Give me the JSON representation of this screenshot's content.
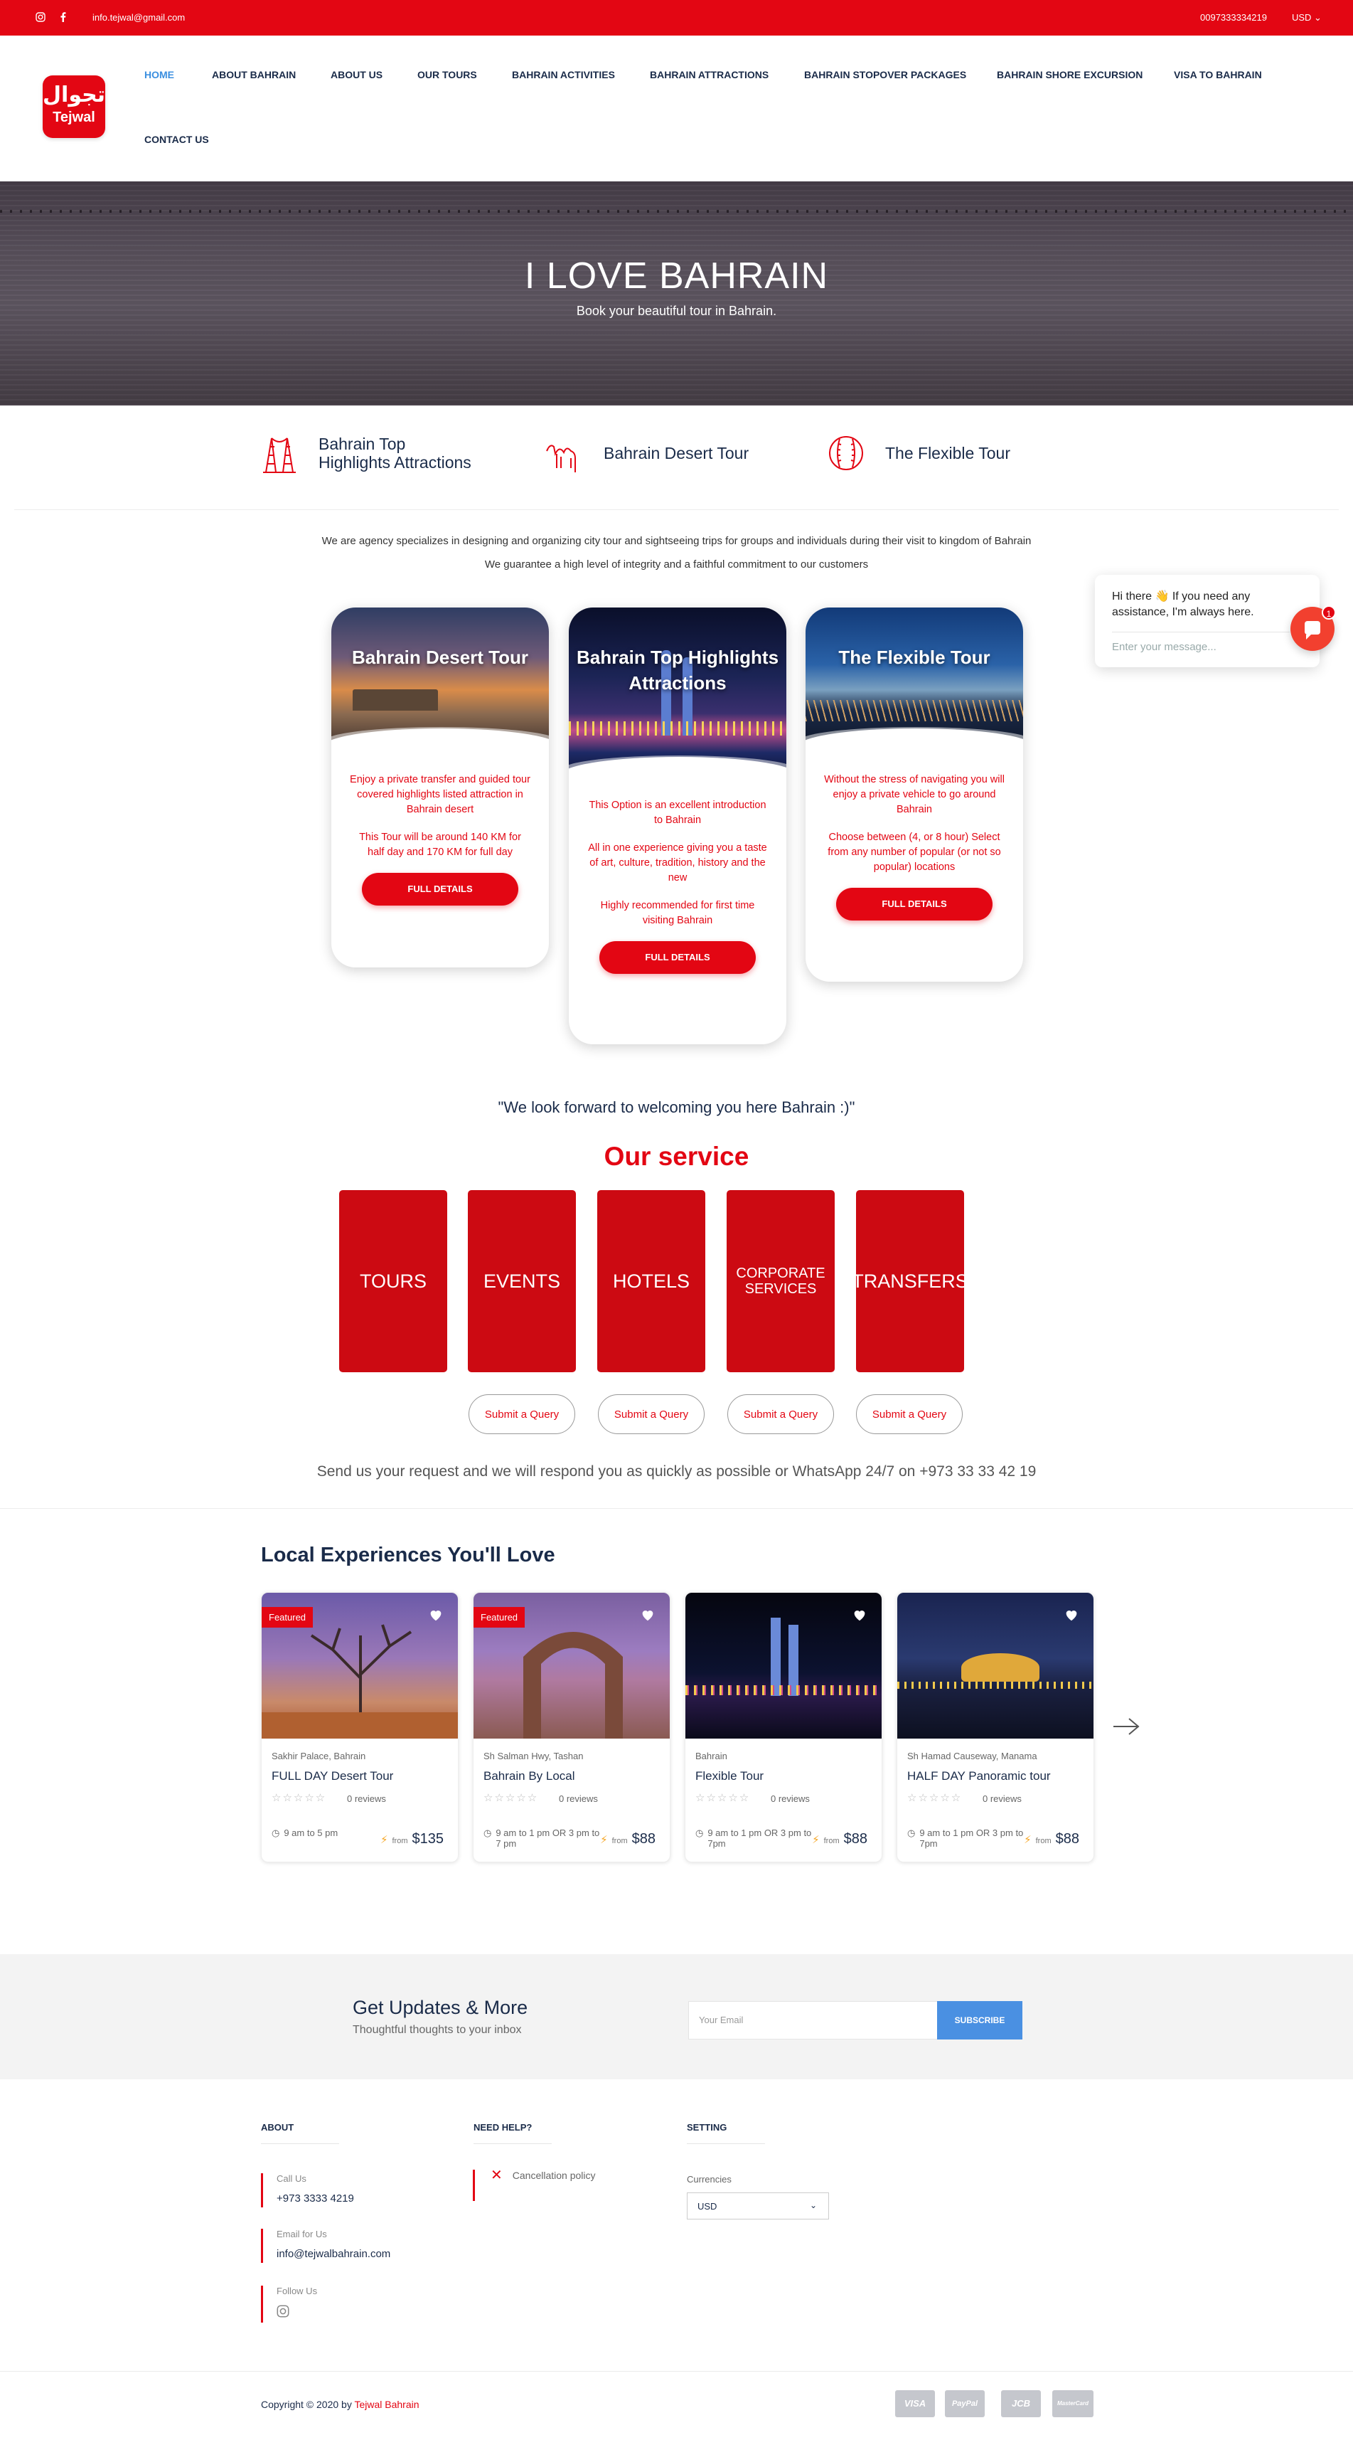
{
  "topbar": {
    "email": "info.tejwal@gmail.com",
    "phone": "0097333334219",
    "currency": "USD ⌄"
  },
  "logo": {
    "arabic": "تجوال",
    "latin": "Tejwal"
  },
  "nav": [
    "HOME",
    "ABOUT BAHRAIN",
    "ABOUT US",
    "OUR TOURS",
    "BAHRAIN ACTIVITIES",
    "BAHRAIN ATTRACTIONS",
    "BAHRAIN STOPOVER PACKAGES",
    "BAHRAIN SHORE EXCURSION",
    "VISA TO BAHRAIN",
    "CONTACT US"
  ],
  "hero": {
    "title": "I LOVE BAHRAIN",
    "subtitle": "Book your beautiful tour in Bahrain."
  },
  "features": [
    {
      "label": "Bahrain Top Highlights Attractions",
      "icon": "towers-icon"
    },
    {
      "label": "Bahrain Desert Tour",
      "icon": "camel-icon"
    },
    {
      "label": "The Flexible Tour",
      "icon": "ball-icon"
    }
  ],
  "intro": [
    "We are agency specializes in designing and organizing city tour and sightseeing trips for groups and individuals during their visit to kingdom of Bahrain",
    "We guarantee a high level of integrity and a faithful commitment to our customers"
  ],
  "tour_cards": [
    {
      "title": "Bahrain Desert Tour",
      "paragraphs": [
        "Enjoy a private transfer and guided tour covered highlights listed attraction in Bahrain desert",
        "This Tour will be around 140 KM for half day and 170 KM for full day"
      ],
      "button": "FULL DETAILS"
    },
    {
      "title": "Bahrain Top Highlights Attractions",
      "paragraphs": [
        "This Option is an excellent introduction to Bahrain",
        "All in one experience giving you a taste of art, culture, tradition, history and the new",
        "Highly recommended for first time visiting Bahrain"
      ],
      "button": "FULL DETAILS"
    },
    {
      "title": "The Flexible Tour",
      "paragraphs": [
        "Without the stress of navigating you will enjoy a private vehicle to go around Bahrain",
        "Choose between (4, or 8 hour) Select from any number of popular (or not so popular) locations"
      ],
      "button": "FULL DETAILS"
    }
  ],
  "chat": {
    "message": "Hi there 👋 If you need any assistance, I'm always here.",
    "placeholder": "Enter your message...",
    "badge": "1"
  },
  "quote": "\"We look forward to welcoming you here Bahrain :)\"",
  "services": {
    "title": "Our service",
    "items": [
      "TOURS",
      "EVENTS",
      "HOTELS",
      "CORPORATE SERVICES",
      "TRANSFERS"
    ],
    "query_label": "Submit a Query",
    "request_text": "Send us your request and we will respond you as quickly as possible or WhatsApp 24/7 on +973 33 33 42 19"
  },
  "experiences": {
    "title": "Local Experiences You'll Love",
    "items": [
      {
        "featured": "Featured",
        "location": "Sakhir Palace, Bahrain",
        "name": "FULL DAY Desert Tour",
        "stars": "☆☆☆☆☆",
        "reviews": "0 reviews",
        "hours": "9 am to 5 pm",
        "from": "from",
        "price": "$135"
      },
      {
        "featured": "Featured",
        "location": "Sh Salman Hwy, Tashan",
        "name": "Bahrain By Local",
        "stars": "☆☆☆☆☆",
        "reviews": "0 reviews",
        "hours": "9 am to 1 pm OR 3 pm to 7 pm",
        "from": "from",
        "price": "$88"
      },
      {
        "featured": "",
        "location": "Bahrain",
        "name": "Flexible Tour",
        "stars": "☆☆☆☆☆",
        "reviews": "0 reviews",
        "hours": "9 am to 1 pm OR 3 pm to 7pm",
        "from": "from",
        "price": "$88"
      },
      {
        "featured": "",
        "location": "Sh Hamad Causeway, Manama",
        "name": "HALF DAY Panoramic tour",
        "stars": "☆☆☆☆☆",
        "reviews": "0 reviews",
        "hours": "9 am to 1 pm OR 3 pm to 7pm",
        "from": "from",
        "price": "$88"
      }
    ]
  },
  "newsletter": {
    "title": "Get Updates & More",
    "subtitle": "Thoughtful thoughts to your inbox",
    "placeholder": "Your Email",
    "button": "SUBSCRIBE"
  },
  "footer": {
    "about": "ABOUT",
    "help": "NEED HELP?",
    "setting": "SETTING",
    "call_label": "Call Us",
    "call_value": "+973 3333 4219",
    "email_label": "Email for Us",
    "email_value": "info@tejwalbahrain.com",
    "follow_label": "Follow Us",
    "cancellation": "Cancellation policy",
    "currencies_label": "Currencies",
    "currency_value": "USD",
    "copyright": "Copyright © 2020 by ",
    "brand": "Tejwal Bahrain",
    "payments": [
      "VISA",
      "PayPal",
      "JCB",
      "MasterCard"
    ]
  },
  "colors": {
    "brand_red": "#e30613",
    "nav_active": "#3b8fe0",
    "subscribe_blue": "#4a90e2"
  }
}
